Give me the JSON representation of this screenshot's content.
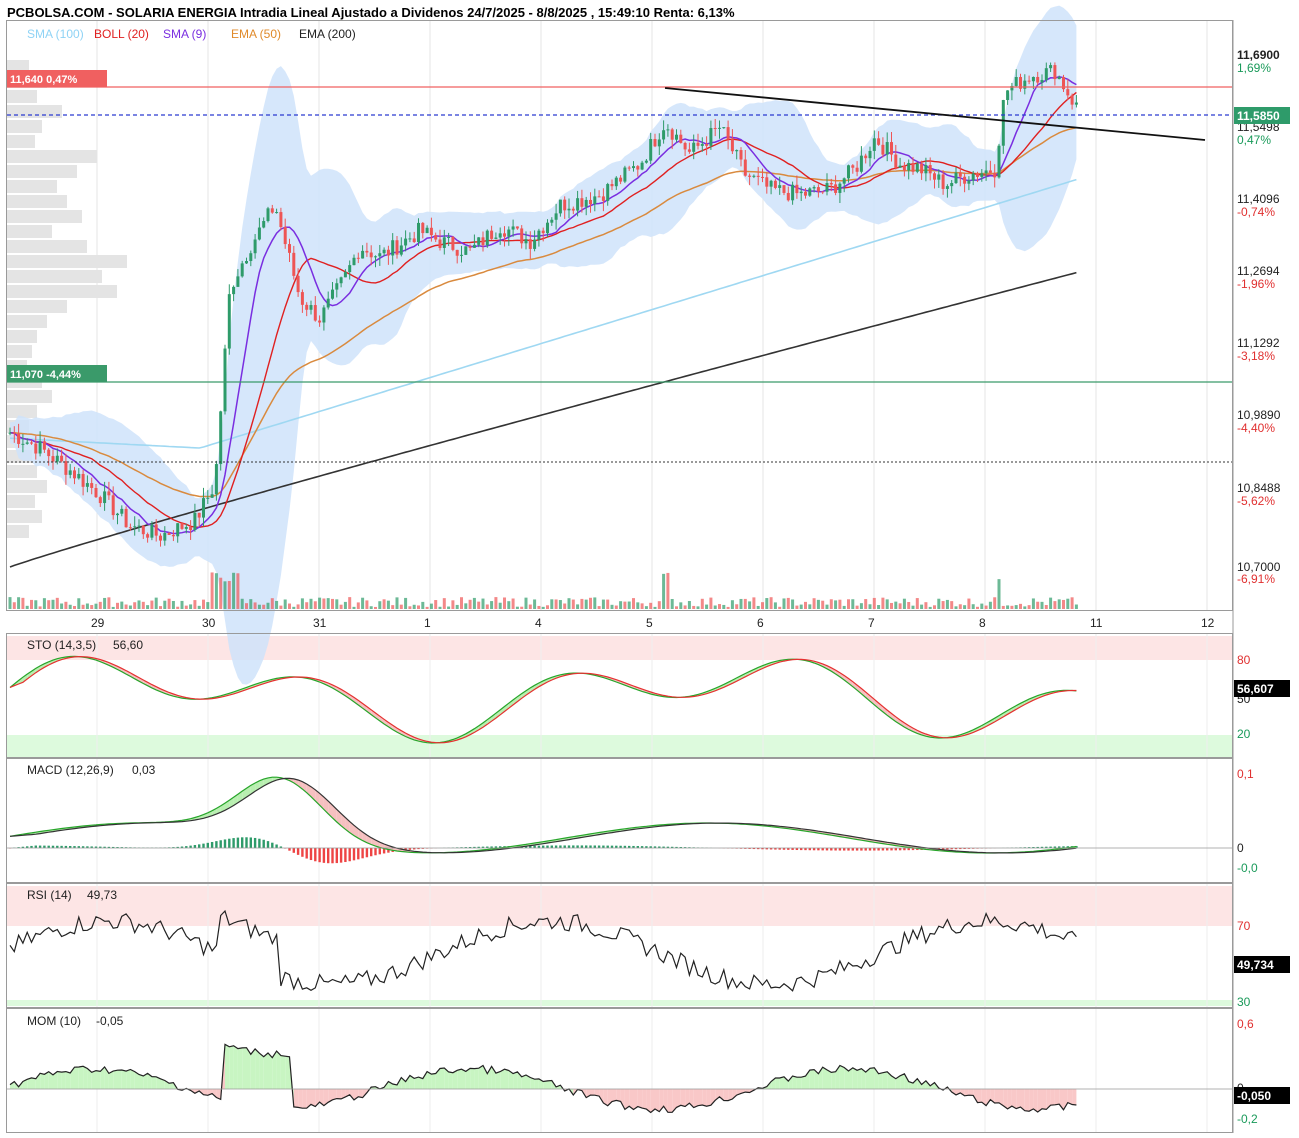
{
  "header": {
    "title": "PCBOLSA.COM - SOLARIA ENERGIA Intradia Lineal Ajustado a Dividenos 24/7/2025 - 8/8/2025 , 15:49:10 Renta: 6,13%",
    "legend": [
      {
        "label": "SMA (100)",
        "color": "#8fd3f5"
      },
      {
        "label": "BOLL (20)",
        "color": "#e02020"
      },
      {
        "label": "SMA (9)",
        "color": "#7a2ee0"
      },
      {
        "label": "EMA (50)",
        "color": "#e08a2a"
      },
      {
        "label": "EMA (200)",
        "color": "#222222"
      }
    ]
  },
  "colors": {
    "up": "#2e9b6a",
    "down": "#ee5555",
    "boll_fill": "#cfe3fa",
    "sma100": "#9fd8f2",
    "sma9": "#7a2ee0",
    "ema50": "#d98a3e",
    "ema200": "#333333",
    "resistance": "#f06060",
    "support": "#3a9a6a",
    "current": "#2a3ad0"
  },
  "main_price_axis": {
    "ticks": [
      {
        "price": "11,6900",
        "pct": "1,69%",
        "color": "#1a9a5a"
      },
      {
        "price": "11,5498",
        "pct": "0,47%",
        "color": "#1a9a5a"
      },
      {
        "price": "11,4096",
        "pct": "-0,74%",
        "color": "#e03030"
      },
      {
        "price": "11,2694",
        "pct": "-1,96%",
        "color": "#e03030"
      },
      {
        "price": "11,1292",
        "pct": "-3,18%",
        "color": "#e03030"
      },
      {
        "price": "10,9890",
        "pct": "-4,40%",
        "color": "#e03030"
      },
      {
        "price": "10,8488",
        "pct": "-5,62%",
        "color": "#e03030"
      },
      {
        "price": "10,7000",
        "pct": "-6,91%",
        "color": "#e03030"
      }
    ],
    "current_price": "11,5850",
    "resistance_label": "11,640  0,47%",
    "support_label": "11,070  -4,44%"
  },
  "x_axis": {
    "labels": [
      "29",
      "30",
      "31",
      "1",
      "4",
      "5",
      "6",
      "7",
      "8",
      "11",
      "12"
    ]
  },
  "panels": {
    "sto": {
      "title": "STO (14,3,5)",
      "value": "56,60",
      "badge": "56,607",
      "ticks": [
        "80",
        "50",
        "20"
      ]
    },
    "macd": {
      "title": "MACD (12,26,9)",
      "value": "0,03",
      "ticks": [
        "0,1",
        "0",
        "-0,0"
      ]
    },
    "rsi": {
      "title": "RSI (14)",
      "value": "49,73",
      "badge": "49,734",
      "ticks": [
        "70",
        "30"
      ]
    },
    "mom": {
      "title": "MOM (10)",
      "value": "-0,05",
      "badge": "-0,050",
      "ticks": [
        "0,6",
        "0",
        "-0,2"
      ]
    }
  },
  "chart_data": {
    "type": "candlestick",
    "title": "PCBOLSA.COM - SOLARIA ENERGIA Intradia Lineal Ajustado a Dividenos 24/7/2025 - 8/8/2025 , 15:49:10 Renta: 6,13%",
    "x_categories": [
      "29",
      "30",
      "31",
      "1",
      "4",
      "5",
      "6",
      "7",
      "8",
      "11",
      "12"
    ],
    "ylim": [
      10.66,
      11.76
    ],
    "current_price": 11.585,
    "resistance": 11.64,
    "support": 11.07,
    "sessions_close": [
      {
        "session": "29",
        "start": 10.96,
        "end": 10.8
      },
      {
        "session": "30",
        "start": 10.8,
        "end": 11.3
      },
      {
        "session": "31",
        "start": 11.44,
        "end": 11.2
      },
      {
        "session": "1",
        "start": 11.2,
        "end": 11.35
      },
      {
        "session": "4",
        "start": 11.35,
        "end": 11.43
      },
      {
        "session": "5",
        "start": 11.55,
        "end": 11.44
      },
      {
        "session": "6",
        "start": 11.44,
        "end": 11.42
      },
      {
        "session": "7",
        "start": 11.5,
        "end": 11.45
      },
      {
        "session": "8",
        "start": 11.58,
        "end": 11.585
      }
    ],
    "indicators_last": {
      "STO (14,3,5)": 56.6,
      "MACD (12,26,9)": 0.03,
      "RSI (14)": 49.73,
      "MOM (10)": -0.05
    }
  }
}
